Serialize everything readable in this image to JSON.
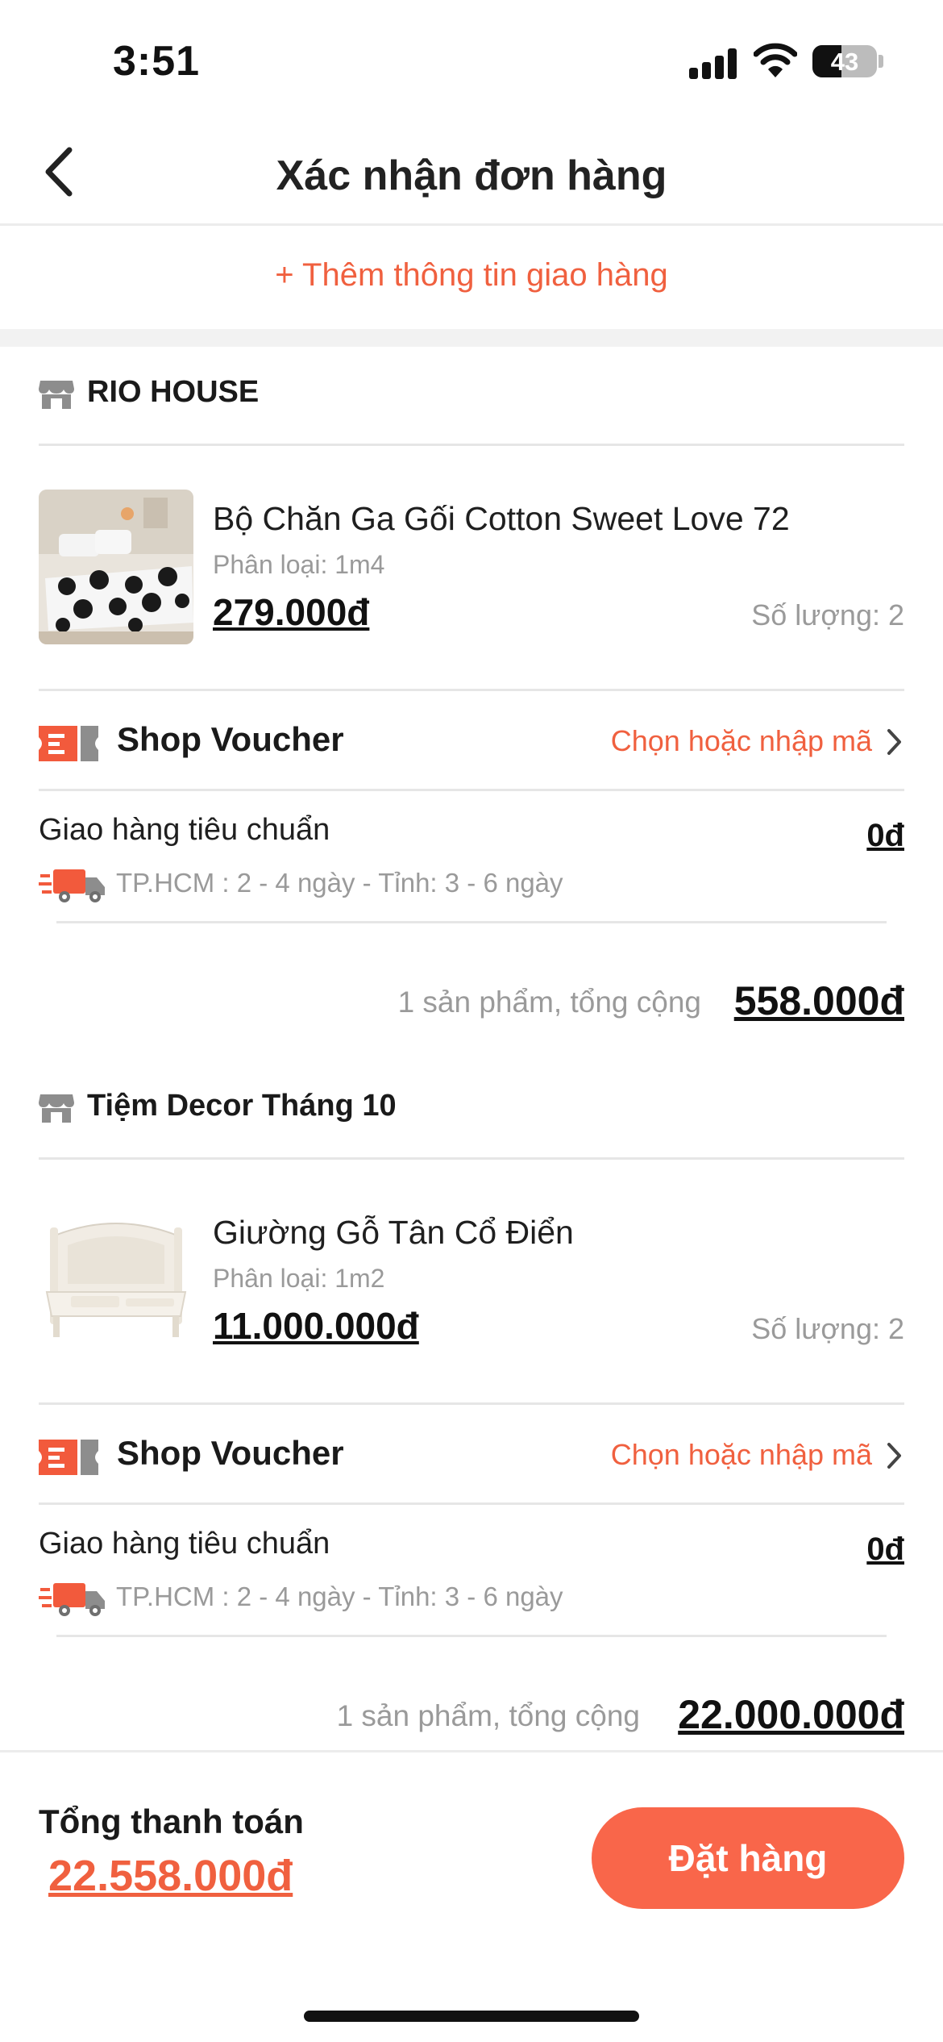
{
  "status_bar": {
    "time": "3:51",
    "battery": "43"
  },
  "header": {
    "title": "Xác nhận đơn hàng",
    "back_icon": "chevron-left-icon"
  },
  "add_shipping_info": "+ Thêm thông tin giao hàng",
  "shops": [
    {
      "name": "RIO HOUSE",
      "product": {
        "name": "Bộ Chăn Ga Gối Cotton Sweet Love 72",
        "variant": "Phân loại: 1m4",
        "price": "279.000đ",
        "quantity": "Số lượng: 2"
      },
      "voucher": {
        "label": "Shop Voucher",
        "action": "Chọn hoặc nhập mã"
      },
      "shipping": {
        "method": "Giao hàng tiêu chuẩn",
        "fee": "0đ",
        "eta": "TP.HCM : 2 - 4 ngày - Tỉnh: 3 - 6 ngày"
      },
      "subtotal_label": "1 sản phẩm, tổng cộng",
      "subtotal_value": "558.000đ"
    },
    {
      "name": "Tiệm Decor Tháng 10",
      "product": {
        "name": "Giường Gỗ Tân Cổ Điển",
        "variant": "Phân loại: 1m2",
        "price": "11.000.000đ",
        "quantity": "Số lượng: 2"
      },
      "voucher": {
        "label": "Shop Voucher",
        "action": "Chọn hoặc nhập mã"
      },
      "shipping": {
        "method": "Giao hàng tiêu chuẩn",
        "fee": "0đ",
        "eta": "TP.HCM : 2 - 4 ngày - Tỉnh: 3 - 6 ngày"
      },
      "subtotal_label": "1 sản phẩm, tổng cộng",
      "subtotal_value": "22.000.000đ"
    }
  ],
  "footer": {
    "total_label": "Tổng thanh toán",
    "total_value": "22.558.000đ",
    "order_button": "Đặt hàng"
  },
  "colors": {
    "accent": "#f0603f",
    "button": "#f9664a",
    "muted": "#9a9a9a",
    "divider": "#e6e6e6"
  }
}
